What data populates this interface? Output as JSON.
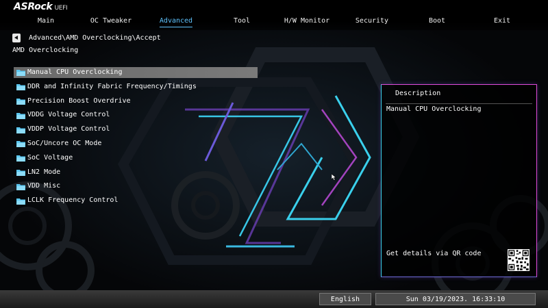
{
  "logo": {
    "brand": "ASRock",
    "suffix": "UEFI"
  },
  "tabs": [
    {
      "label": "Main"
    },
    {
      "label": "OC Tweaker"
    },
    {
      "label": "Advanced",
      "active": true
    },
    {
      "label": "Tool"
    },
    {
      "label": "H/W Monitor"
    },
    {
      "label": "Security"
    },
    {
      "label": "Boot"
    },
    {
      "label": "Exit"
    }
  ],
  "breadcrumb": "Advanced\\AMD Overclocking\\Accept",
  "section_title": "AMD Overclocking",
  "menu": {
    "items": [
      {
        "label": "Manual CPU Overclocking",
        "selected": true
      },
      {
        "label": "DDR and Infinity Fabric Frequency/Timings"
      },
      {
        "label": "Precision Boost Overdrive"
      },
      {
        "label": "VDDG Voltage Control"
      },
      {
        "label": "VDDP Voltage Control"
      },
      {
        "label": "SoC/Uncore OC Mode"
      },
      {
        "label": "SoC Voltage"
      },
      {
        "label": "LN2 Mode"
      },
      {
        "label": "VDD Misc"
      },
      {
        "label": "LCLK Frequency Control"
      }
    ]
  },
  "description": {
    "title": "Description",
    "text": "Manual CPU Overclocking",
    "qr_label": "Get details via QR code"
  },
  "footer": {
    "language": "English",
    "datetime": "Sun 03/19/2023. 16:33:10"
  },
  "colors": {
    "active_tab": "#5fc4ff",
    "selection": "#6a6a6a",
    "panel_border_pink": "#e04bd8",
    "panel_border_cyan": "#3bd2ee",
    "folder_icon": "#5cc8f2"
  }
}
